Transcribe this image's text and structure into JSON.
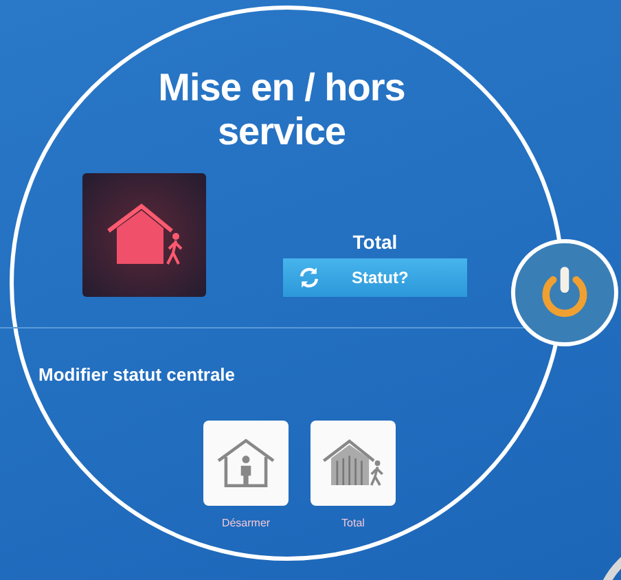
{
  "title": "Mise en / hors service",
  "current_mode": {
    "label": "Total",
    "status_button": "Statut?"
  },
  "section_title": "Modifier statut centrale",
  "modes": [
    {
      "kind": "disarm",
      "label": "Désarmer"
    },
    {
      "kind": "total",
      "label": "Total"
    }
  ]
}
